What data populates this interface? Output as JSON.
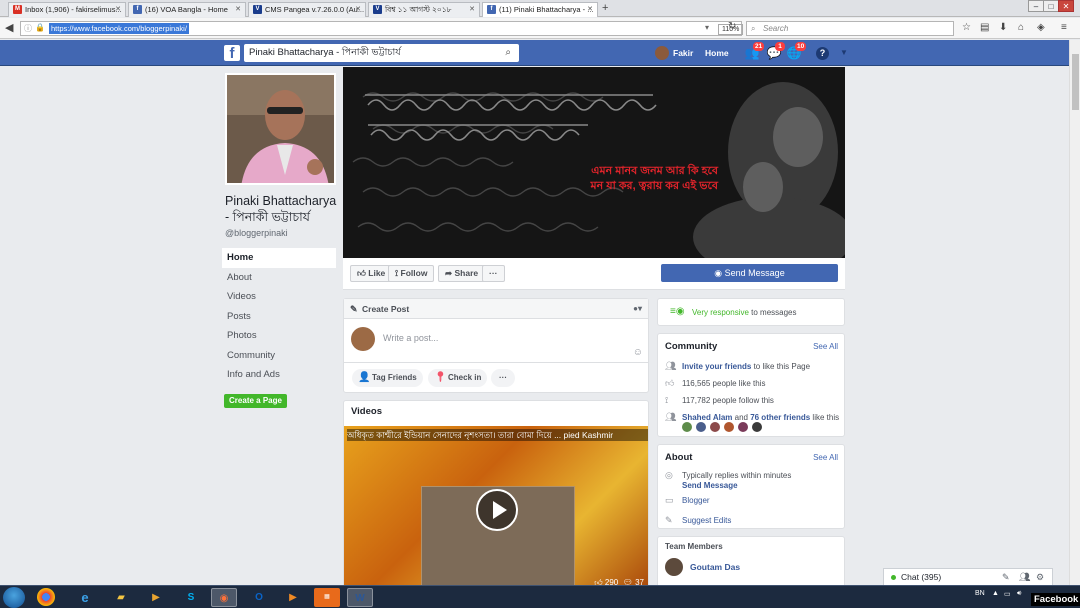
{
  "browser": {
    "tabs": [
      {
        "label": "Inbox (1,906) - fakirselimus...",
        "icon": "gmail-icon",
        "color": "#d93025"
      },
      {
        "label": "(16) VOA Bangla - Home",
        "icon": "facebook-icon",
        "color": "#4267b2"
      },
      {
        "label": "CMS Pangea v.7.26.0.0 (Au...",
        "icon": "voa-icon",
        "color": "#1a3c8c"
      },
      {
        "label": "বিশ্ব ১১ আগস্ট ২০১৮",
        "icon": "voa-icon",
        "color": "#1a3c8c"
      },
      {
        "label": "(11) Pinaki Bhattacharya - ...",
        "icon": "facebook-icon",
        "color": "#4267b2"
      }
    ],
    "url": "https://www.facebook.com/bloggerpinaki/",
    "zoom": "110%",
    "search_placeholder": "Search"
  },
  "fb": {
    "search_value": "Pinaki Bhattacharya - পিনাকী ভট্টাচার্য",
    "user_name": "Fakir",
    "home_label": "Home",
    "badges": {
      "friends": "21",
      "messages": "1",
      "notifications": "10"
    }
  },
  "page": {
    "name": "Pinaki Bhattacharya - পিনাকী ভট্টাচার্য",
    "handle": "@bloggerpinaki",
    "nav": [
      "Home",
      "About",
      "Videos",
      "Posts",
      "Photos",
      "Community",
      "Info and Ads"
    ],
    "create_page_label": "Create a Page",
    "cover_line1": "এমন মানব জনম আর কি হবে",
    "cover_line2": "মন যা কর, ত্বরায় কর এই ভবে"
  },
  "actions": {
    "like": "Like",
    "follow": "Follow",
    "share": "Share",
    "more": "···",
    "send_message": "Send Message"
  },
  "create_post": {
    "title": "Create Post",
    "placeholder": "Write a post...",
    "tag_friends": "Tag Friends",
    "check_in": "Check in",
    "more": "···"
  },
  "videos": {
    "title": "Videos",
    "caption": "অধিকৃত কাশ্মীরে ইন্ডিয়ান সেনাদের নৃশংসতা। তারা বোমা দিয়ে ... pied Kashmir",
    "likes": "290",
    "comments": "37"
  },
  "responsive": {
    "highlight": "Very responsive",
    "rest": " to messages"
  },
  "community": {
    "title": "Community",
    "see_all": "See All",
    "invite_link": "Invite your friends",
    "invite_rest": " to like this Page",
    "likes": "116,565 people like this",
    "follows": "117,782 people follow this",
    "friend_name": "Shahed Alam",
    "friend_and": " and ",
    "friend_others": "76 other friends",
    "friend_rest": " like this"
  },
  "about": {
    "title": "About",
    "see_all": "See All",
    "replies": "Typically replies within minutes",
    "send_message": "Send Message",
    "category": "Blogger",
    "suggest": "Suggest Edits"
  },
  "team": {
    "title": "Team Members",
    "member": "Goutam Das"
  },
  "chat": {
    "label": "Chat (395)"
  },
  "taskbar": {
    "lang": "BN",
    "watermark": "Facebook"
  }
}
